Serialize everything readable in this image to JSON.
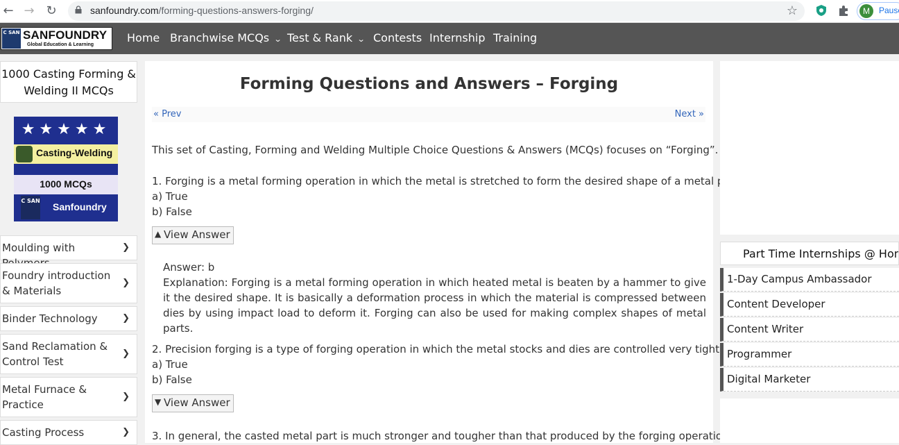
{
  "browser": {
    "url_host": "sanfoundry.com",
    "url_path": "/forming-questions-answers-forging/",
    "profile_initial": "M",
    "profile_status": "Pause"
  },
  "navbar": {
    "logo_name": "SANFOUNDRY",
    "logo_tagline": "Global Education & Learning",
    "logo_badge": "C SAN",
    "items": [
      {
        "label": "Home",
        "dropdown": false
      },
      {
        "label": "Branchwise MCQs",
        "dropdown": true
      },
      {
        "label": "Test & Rank",
        "dropdown": true
      },
      {
        "label": "Contests",
        "dropdown": false
      },
      {
        "label": "Internship",
        "dropdown": false
      },
      {
        "label": "Training",
        "dropdown": false
      }
    ]
  },
  "sidebar": {
    "title": "1000 Casting Forming & Welding II MCQs",
    "book": {
      "stars": "★★★★★",
      "band1": "Casting-Welding",
      "band2": "1000 MCQs",
      "badge": "C SAN",
      "brand": "Sanfoundry"
    },
    "items": [
      {
        "label": "Moulding with Polymers"
      },
      {
        "label": "Foundry introduction & Materials"
      },
      {
        "label": "Binder Technology"
      },
      {
        "label": "Sand Reclamation & Control Test"
      },
      {
        "label": "Metal Furnace & Practice"
      },
      {
        "label": "Casting Process"
      }
    ]
  },
  "main": {
    "title": "Forming Questions and Answers – Forging",
    "prev": "« Prev",
    "next": "Next »",
    "intro": "This set of Casting, Forming and Welding Multiple Choice Questions & Answers (MCQs) focuses on “Forging”.",
    "q1": {
      "question": "1. Forging is a metal forming operation in which the metal is stretched to form the desired shape of a metal part.",
      "option_a": "a) True",
      "option_b": "b) False",
      "button": "View Answer",
      "answer": "Answer: b",
      "explanation": "Explanation: Forging is a metal forming operation in which heated metal is beaten by a hammer to give it the desired shape. It is basically a deformation process in which the material is compressed between dies by using impact load to deform it. Forging can also be used for making complex shapes of metal parts."
    },
    "q2": {
      "question": "2. Precision forging is a type of forging operation in which the metal stocks and dies are controlled very tightly.",
      "option_a": "a) True",
      "option_b": "b) False",
      "button": "View Answer"
    },
    "q3": {
      "question": "3. In general, the casted metal part is much stronger and tougher than that produced by the forging operation."
    }
  },
  "right": {
    "internships_title": "Part Time Internships @ Home",
    "internships": [
      {
        "label": "1-Day Campus Ambassador"
      },
      {
        "label": "Content Developer"
      },
      {
        "label": "Content Writer"
      },
      {
        "label": "Programmer"
      },
      {
        "label": "Digital Marketer"
      }
    ]
  }
}
